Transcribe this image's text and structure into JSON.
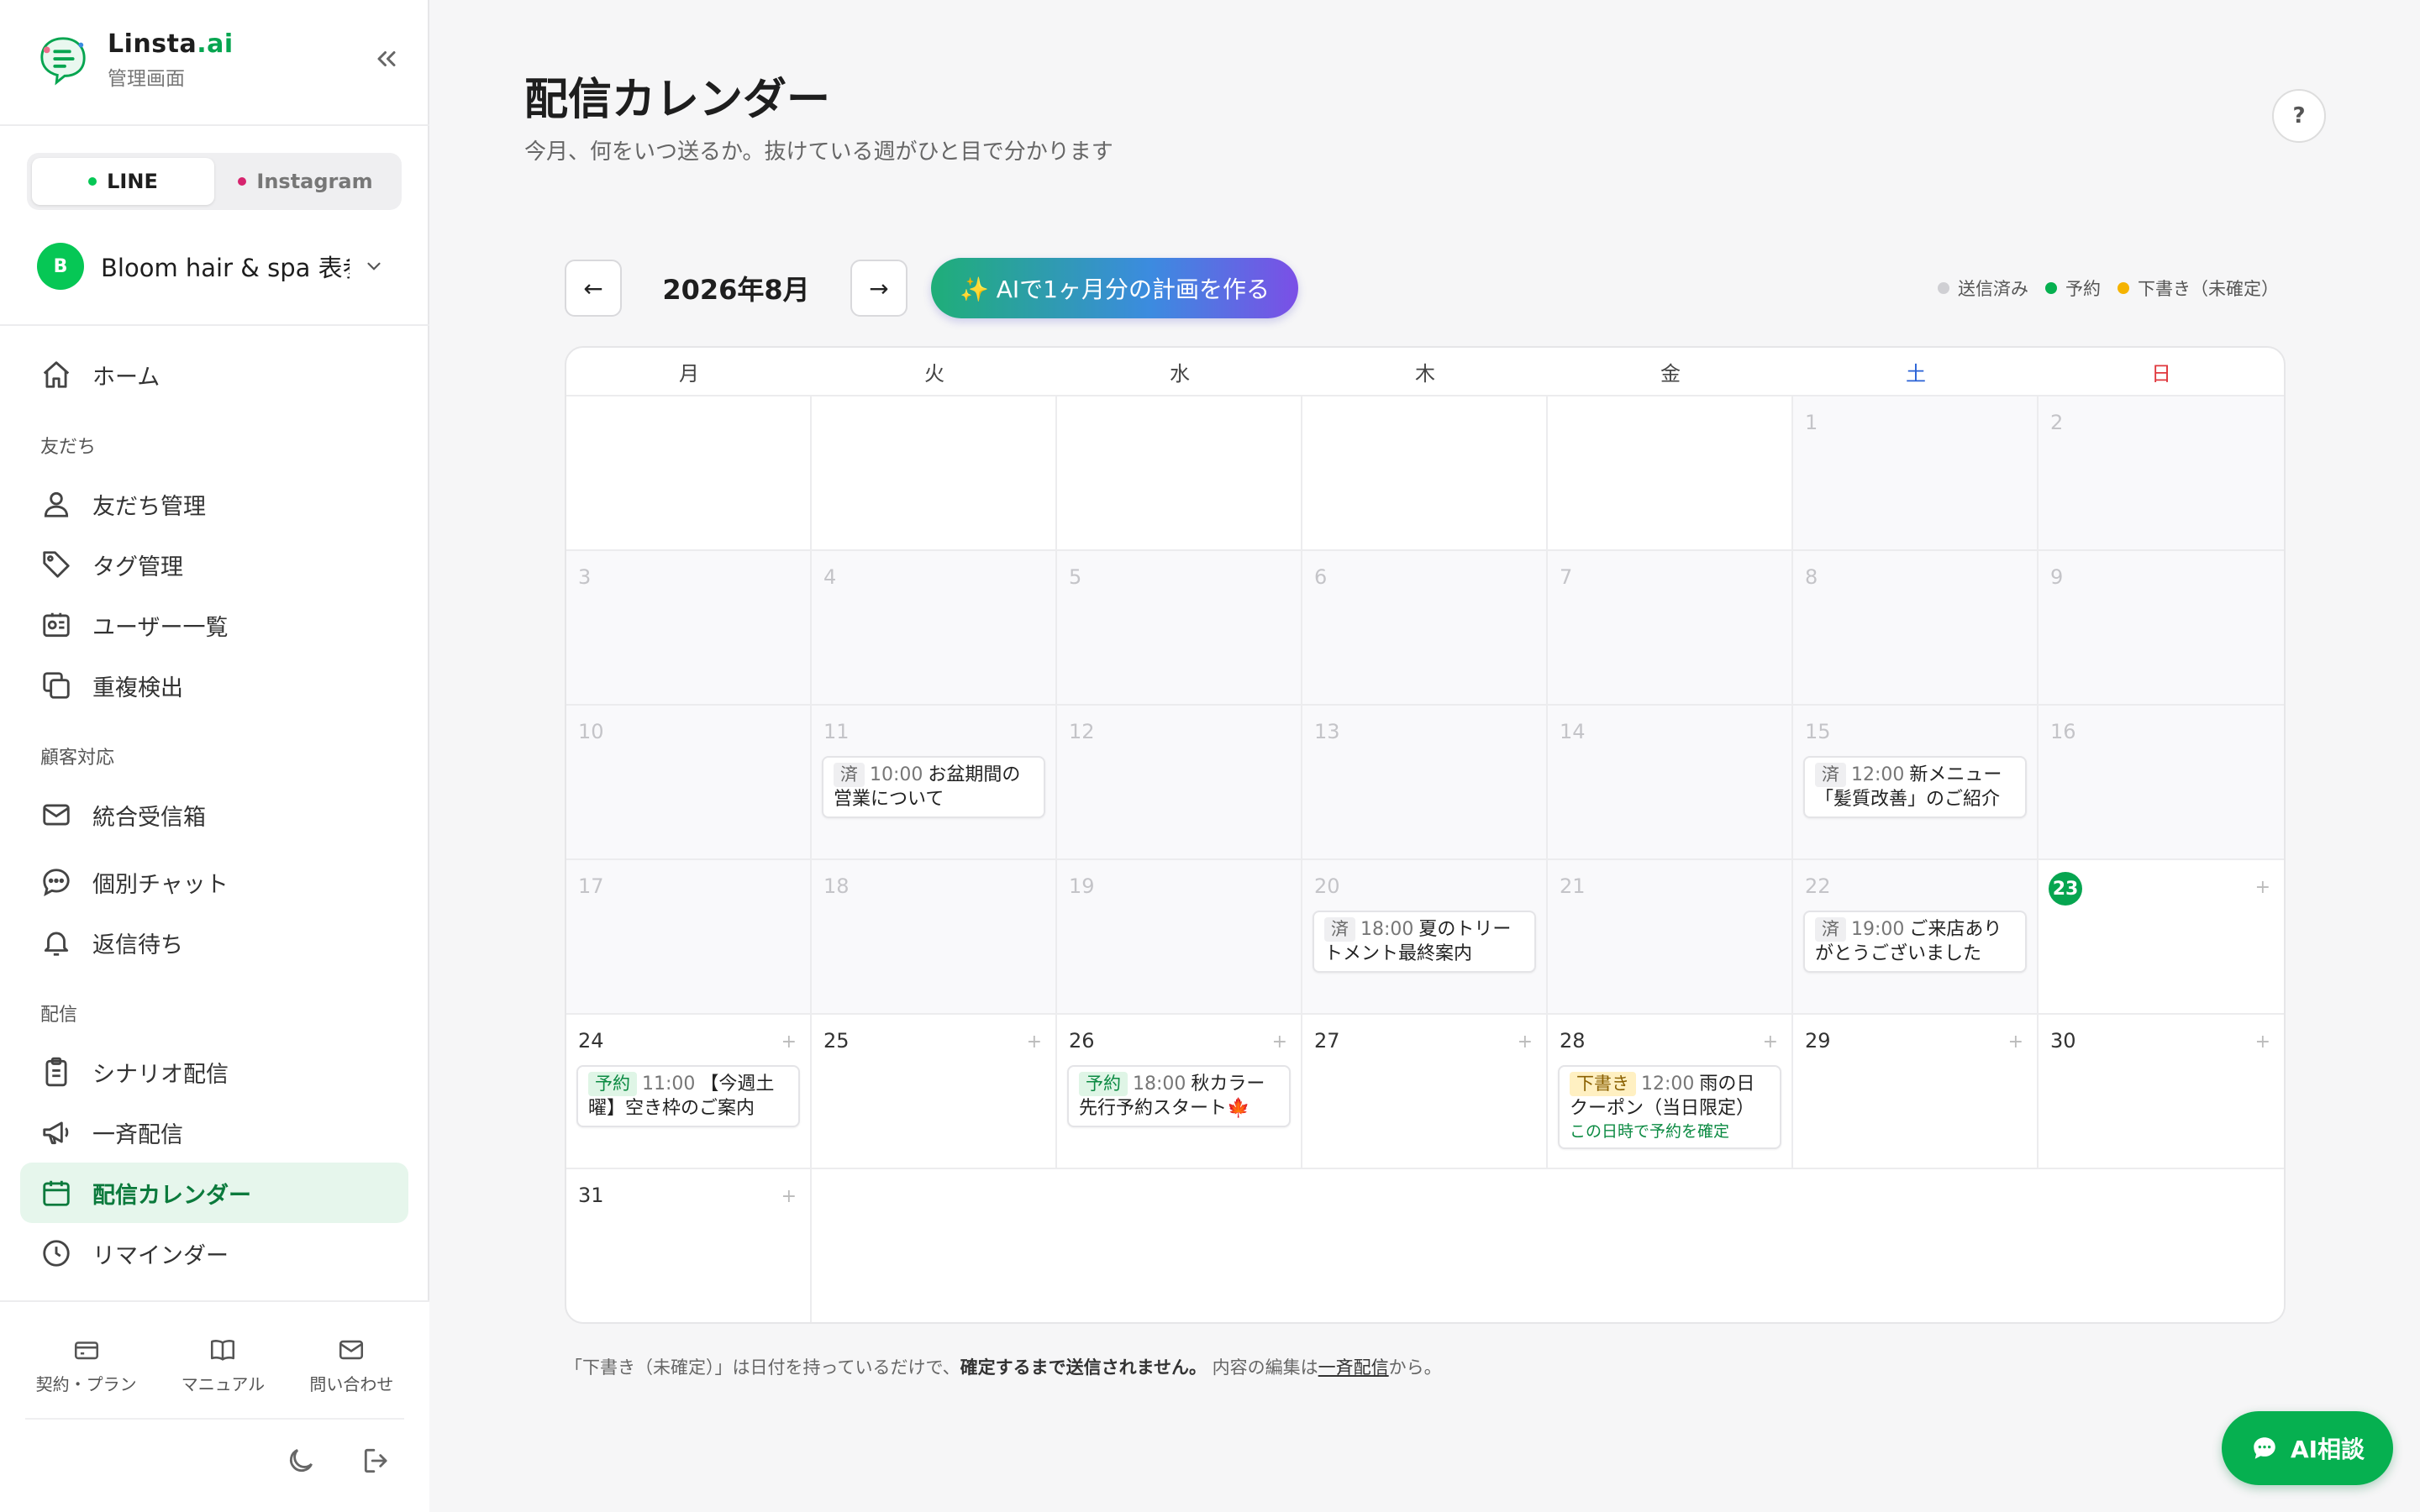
{
  "brand": {
    "name_main": "Linsta",
    "name_suffix": ".ai",
    "subtitle": "管理画面"
  },
  "channels": [
    {
      "label": "LINE",
      "color": "#06c755",
      "active": true
    },
    {
      "label": "Instagram",
      "color": "#d6246e",
      "active": false
    }
  ],
  "account": {
    "initial": "B",
    "name": "Bloom hair & spa 表参道"
  },
  "nav": {
    "home": "ホーム",
    "section_friends": "友だち",
    "friends_manage": "友だち管理",
    "tag_manage": "タグ管理",
    "user_list": "ユーザー一覧",
    "duplicate": "重複検出",
    "section_support": "顧客対応",
    "inbox": "統合受信箱",
    "chat": "個別チャット",
    "awaiting": "返信待ち",
    "section_delivery": "配信",
    "scenario": "シナリオ配信",
    "broadcast": "一斉配信",
    "calendar": "配信カレンダー",
    "reminder": "リマインダー"
  },
  "bottom": {
    "contract": "契約・プラン",
    "manual": "マニュアル",
    "contact": "問い合わせ"
  },
  "page": {
    "title": "配信カレンダー",
    "subtitle": "今月、何をいつ送るか。抜けている週がひと目で分かります",
    "help": "?"
  },
  "toolbar": {
    "prev": "←",
    "next": "→",
    "month": "2026年8月",
    "ai_plan": "✨ AIで1ヶ月分の計画を作る"
  },
  "legend": {
    "sent": {
      "label": "送信済み",
      "color": "#cfcfd3"
    },
    "scheduled": {
      "label": "予約",
      "color": "#06b050"
    },
    "draft": {
      "label": "下書き（未確定）",
      "color": "#f5b300"
    }
  },
  "weekdays": [
    "月",
    "火",
    "水",
    "木",
    "金",
    "土",
    "日"
  ],
  "days": {
    "d1": "1",
    "d2": "2",
    "d3": "3",
    "d4": "4",
    "d5": "5",
    "d6": "6",
    "d7": "7",
    "d8": "8",
    "d9": "9",
    "d10": "10",
    "d11": "11",
    "d12": "12",
    "d13": "13",
    "d14": "14",
    "d15": "15",
    "d16": "16",
    "d17": "17",
    "d18": "18",
    "d19": "19",
    "d20": "20",
    "d21": "21",
    "d22": "22",
    "d23": "23",
    "d24": "24",
    "d25": "25",
    "d26": "26",
    "d27": "27",
    "d28": "28",
    "d29": "29",
    "d30": "30",
    "d31": "31"
  },
  "add_symbol": "+",
  "events": {
    "e11": {
      "badge": "済",
      "time": "10:00",
      "title": "お盆期間の営業について"
    },
    "e15": {
      "badge": "済",
      "time": "12:00",
      "title": "新メニュー「髪質改善」のご紹介"
    },
    "e20": {
      "badge": "済",
      "time": "18:00",
      "title": "夏のトリートメント最終案内"
    },
    "e22": {
      "badge": "済",
      "time": "19:00",
      "title": "ご来店ありがとうございました"
    },
    "e24": {
      "badge": "予約",
      "time": "11:00",
      "title": "【今週土曜】空き枠のご案内"
    },
    "e26": {
      "badge": "予約",
      "time": "18:00",
      "title": "秋カラー先行予約スタート🍁"
    },
    "e28": {
      "badge": "下書き",
      "time": "12:00",
      "title": "雨の日クーポン（当日限定）",
      "confirm": "この日時で予約を確定"
    }
  },
  "footnote": {
    "part1": "「下書き（未確定）」は日付を持っているだけで、",
    "bold": "確定するまで送信されません。",
    "part2": " 内容の編集は",
    "link": "一斉配信",
    "part3": "から。"
  },
  "ai_chat": "AI相談"
}
